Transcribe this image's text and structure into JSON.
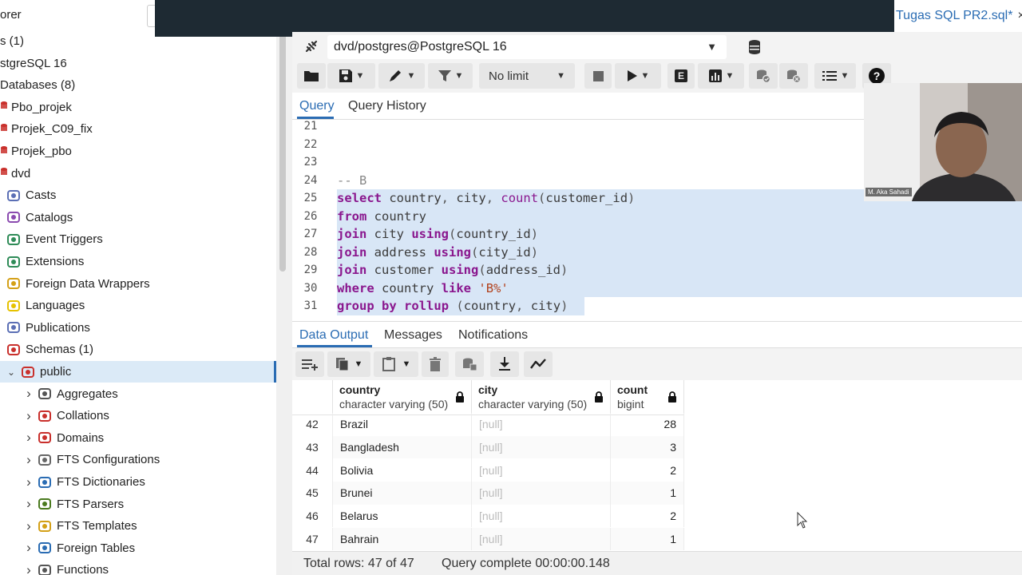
{
  "explorer": {
    "title": "orer",
    "items": [
      {
        "label": "s (1)",
        "icon": "server-group-icon",
        "depth": "root"
      },
      {
        "label": "stgreSQL 16",
        "icon": "server-icon",
        "depth": "root"
      },
      {
        "label": "Databases (8)",
        "icon": "databases-icon",
        "depth": "root"
      },
      {
        "label": "Pbo_projek",
        "icon": "database-icon",
        "depth": "db"
      },
      {
        "label": "Projek_C09_fix",
        "icon": "database-icon",
        "depth": "db"
      },
      {
        "label": "Projek_pbo",
        "icon": "database-icon",
        "depth": "db"
      },
      {
        "label": "dvd",
        "icon": "database-icon",
        "depth": "db"
      },
      {
        "label": "Casts",
        "icon": "casts-icon",
        "depth": "child"
      },
      {
        "label": "Catalogs",
        "icon": "catalogs-icon",
        "depth": "child"
      },
      {
        "label": "Event Triggers",
        "icon": "event-triggers-icon",
        "depth": "child"
      },
      {
        "label": "Extensions",
        "icon": "extensions-icon",
        "depth": "child"
      },
      {
        "label": "Foreign Data Wrappers",
        "icon": "foreign-data-wrappers-icon",
        "depth": "child"
      },
      {
        "label": "Languages",
        "icon": "languages-icon",
        "depth": "child"
      },
      {
        "label": "Publications",
        "icon": "publications-icon",
        "depth": "child"
      },
      {
        "label": "Schemas (1)",
        "icon": "schemas-icon",
        "depth": "child"
      },
      {
        "label": "public",
        "icon": "schema-icon",
        "depth": "child",
        "selected": true
      },
      {
        "label": "Aggregates",
        "icon": "aggregates-icon",
        "depth": "grand"
      },
      {
        "label": "Collations",
        "icon": "collations-icon",
        "depth": "grand"
      },
      {
        "label": "Domains",
        "icon": "domains-icon",
        "depth": "grand"
      },
      {
        "label": "FTS Configurations",
        "icon": "fts-configurations-icon",
        "depth": "grand"
      },
      {
        "label": "FTS Dictionaries",
        "icon": "fts-dictionaries-icon",
        "depth": "grand"
      },
      {
        "label": "FTS Parsers",
        "icon": "fts-parsers-icon",
        "depth": "grand"
      },
      {
        "label": "FTS Templates",
        "icon": "fts-templates-icon",
        "depth": "grand"
      },
      {
        "label": "Foreign Tables",
        "icon": "foreign-tables-icon",
        "depth": "grand"
      },
      {
        "label": "Functions",
        "icon": "functions-icon",
        "depth": "grand"
      }
    ]
  },
  "tab": {
    "title": "Tugas SQL PR2.sql*",
    "close": "×"
  },
  "connection": {
    "label": "dvd/postgres@PostgreSQL 16"
  },
  "toolbar": {
    "limit": "No limit"
  },
  "query_tabs": [
    "Query",
    "Query History"
  ],
  "editor": {
    "lines": [
      {
        "num": "21",
        "code": ""
      },
      {
        "num": "22",
        "code": ""
      },
      {
        "num": "23",
        "code": ""
      },
      {
        "num": "24",
        "code": "-- B"
      },
      {
        "num": "25",
        "code": "select country, city, count(customer_id)"
      },
      {
        "num": "26",
        "code": "from country"
      },
      {
        "num": "27",
        "code": "join city using(country_id)"
      },
      {
        "num": "28",
        "code": "join address using(city_id)"
      },
      {
        "num": "29",
        "code": "join customer using(address_id)"
      },
      {
        "num": "30",
        "code": "where country like 'B%'"
      },
      {
        "num": "31",
        "code": "group by rollup (country, city)"
      }
    ]
  },
  "webcam": {
    "name": "M. Aka Sahadi"
  },
  "output_tabs": [
    "Data Output",
    "Messages",
    "Notifications"
  ],
  "grid": {
    "columns": [
      {
        "name": "country",
        "type": "character varying (50)"
      },
      {
        "name": "city",
        "type": "character varying (50)"
      },
      {
        "name": "count",
        "type": "bigint"
      }
    ],
    "rows": [
      {
        "n": "42",
        "country": "Brazil",
        "city": "[null]",
        "count": "28"
      },
      {
        "n": "43",
        "country": "Bangladesh",
        "city": "[null]",
        "count": "3"
      },
      {
        "n": "44",
        "country": "Bolivia",
        "city": "[null]",
        "count": "2"
      },
      {
        "n": "45",
        "country": "Brunei",
        "city": "[null]",
        "count": "1"
      },
      {
        "n": "46",
        "country": "Belarus",
        "city": "[null]",
        "count": "2"
      },
      {
        "n": "47",
        "country": "Bahrain",
        "city": "[null]",
        "count": "1"
      }
    ]
  },
  "status": {
    "rows": "Total rows: 47 of 47",
    "query": "Query complete 00:00:00.148"
  },
  "colors": {
    "accent": "#2a6cb3",
    "keyword": "#8a178e",
    "string": "#b2421d",
    "selection": "#d8e6f6"
  }
}
